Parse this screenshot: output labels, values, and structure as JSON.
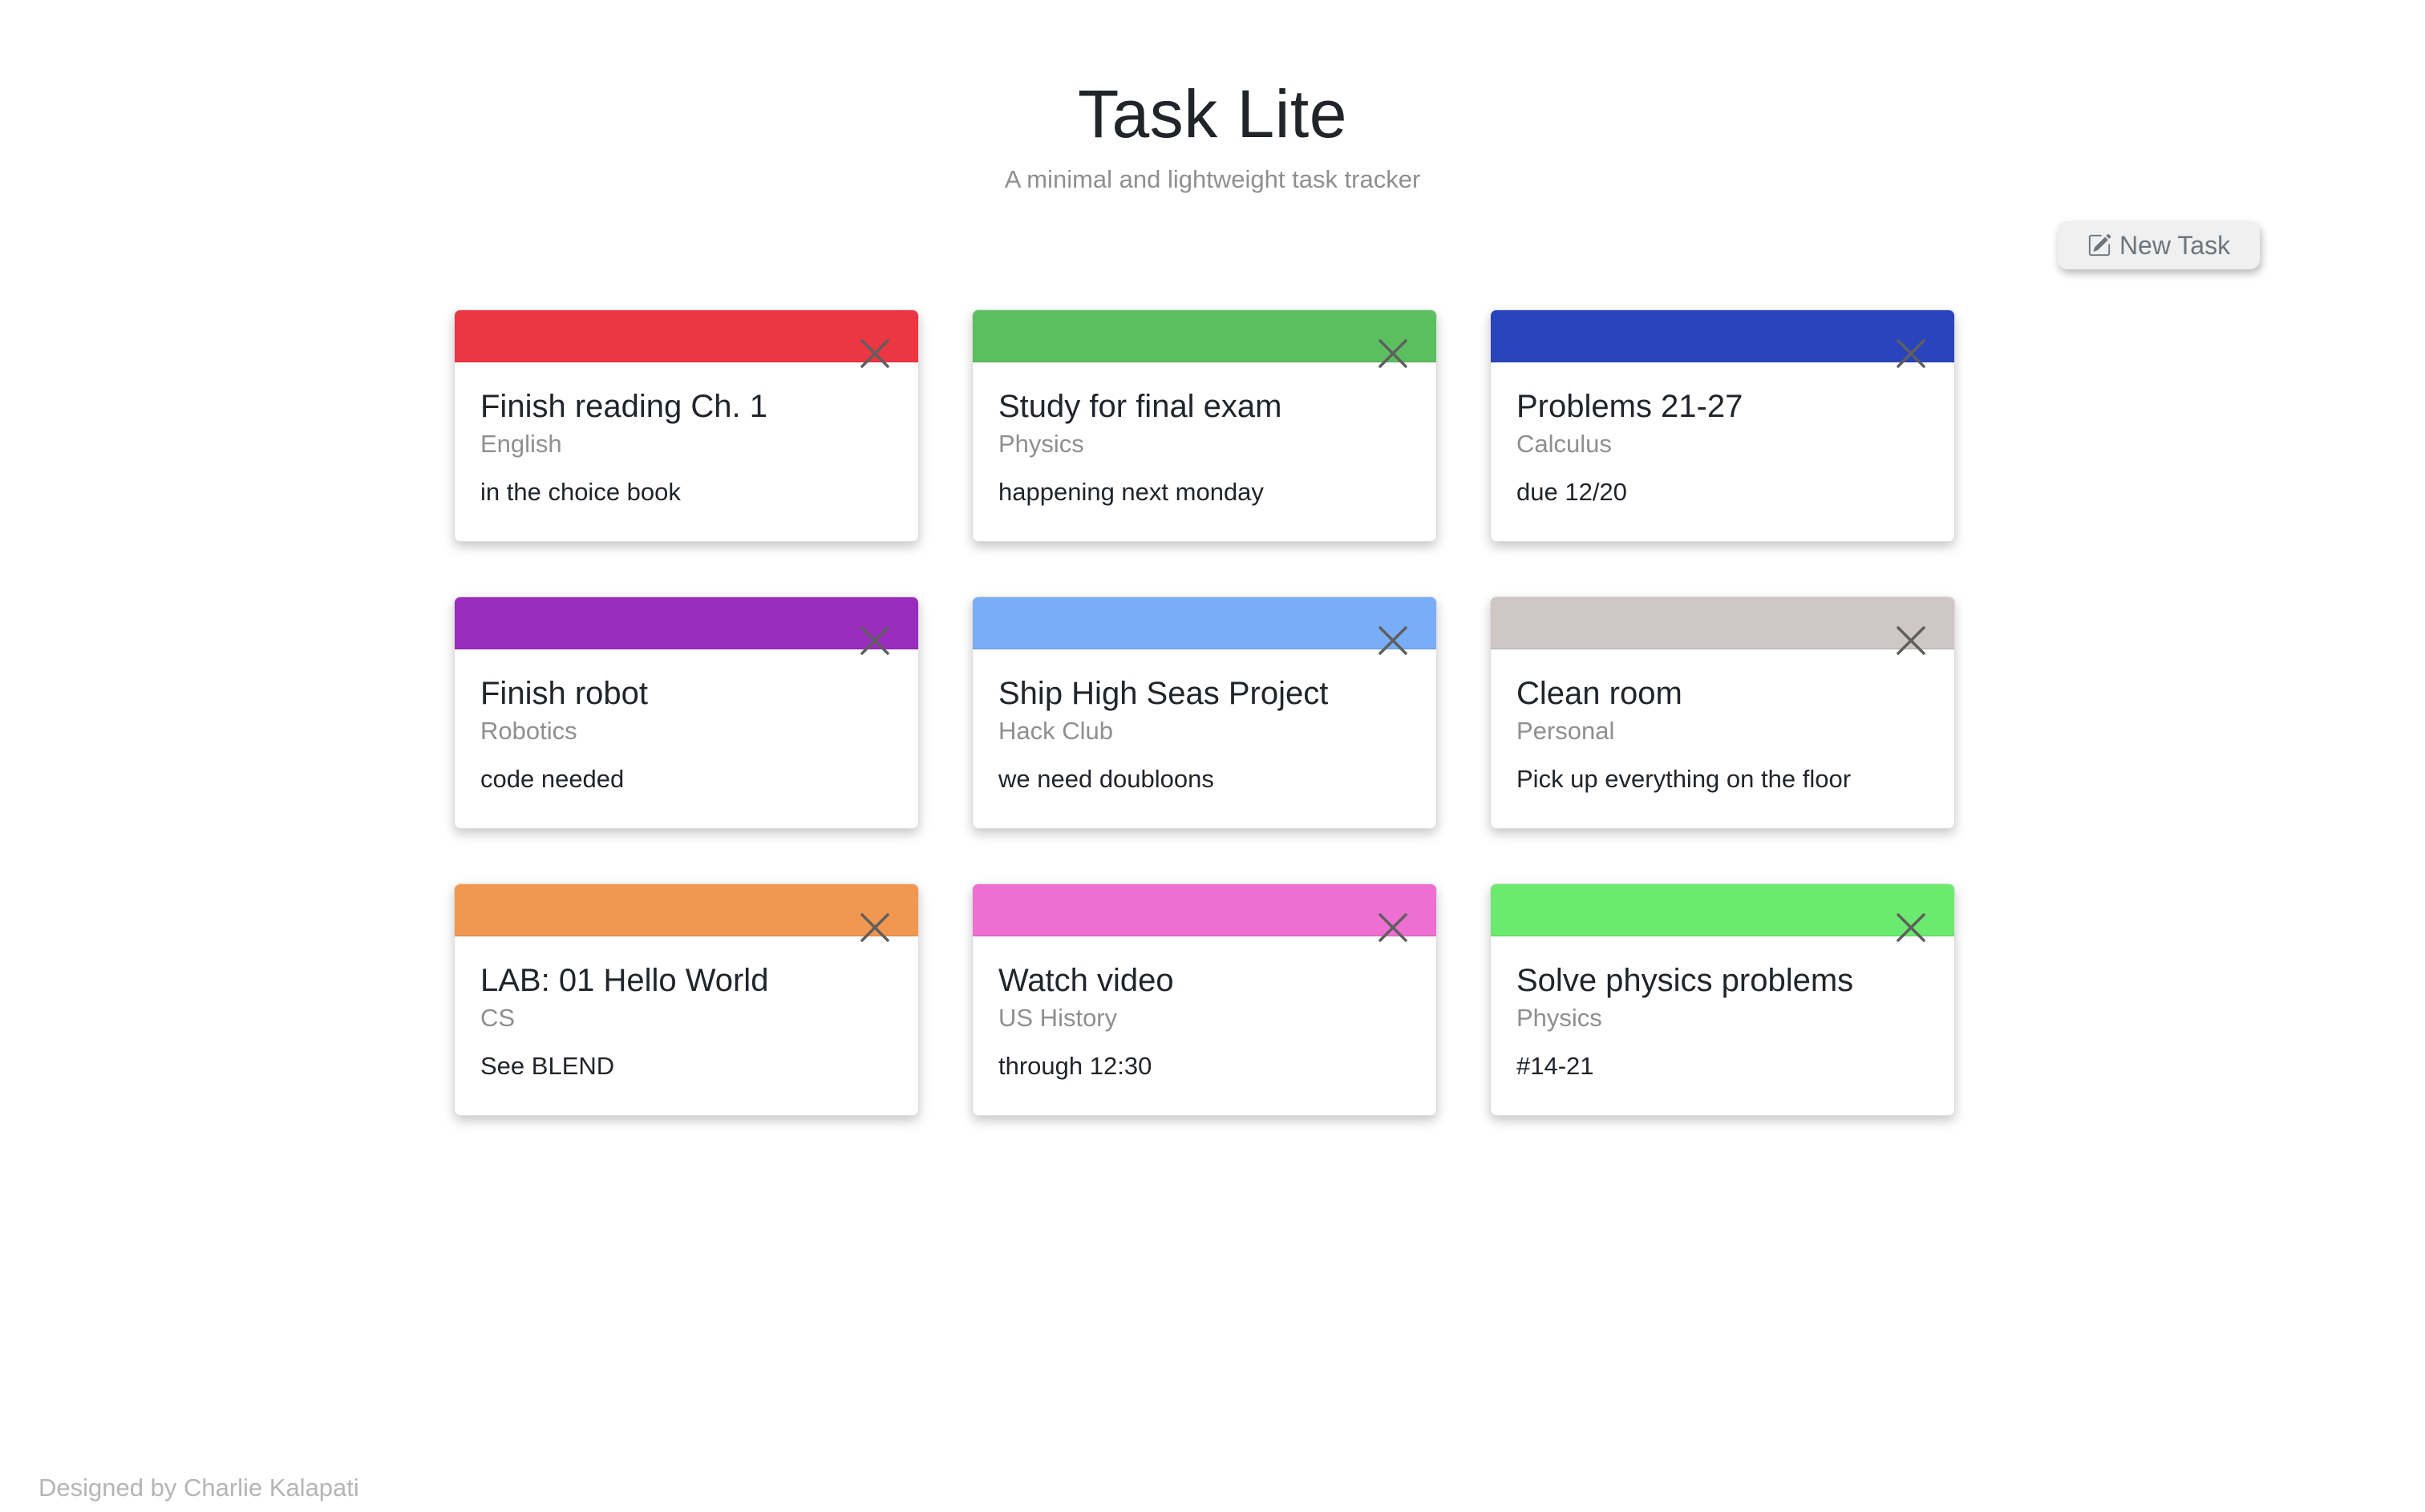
{
  "header": {
    "title": "Task Lite",
    "subtitle": "A minimal and lightweight task tracker"
  },
  "toolbar": {
    "new_task_label": "New Task",
    "new_task_icon": "edit-square-icon"
  },
  "tasks": [
    {
      "title": "Finish reading Ch. 1",
      "subject": "English",
      "notes": "in the choice book",
      "color": "#ec3642"
    },
    {
      "title": "Study for final exam",
      "subject": "Physics",
      "notes": "happening next monday",
      "color": "#5bbf5f"
    },
    {
      "title": "Problems 21-27",
      "subject": "Calculus",
      "notes": "due 12/20",
      "color": "#2a44bd"
    },
    {
      "title": "Finish robot",
      "subject": "Robotics",
      "notes": "code needed",
      "color": "#9a2cbd"
    },
    {
      "title": "Ship High Seas Project",
      "subject": "Hack Club",
      "notes": "we need doubloons",
      "color": "#79aef7"
    },
    {
      "title": "Clean room",
      "subject": "Personal",
      "notes": "Pick up everything on the floor",
      "color": "#cfc6c6"
    },
    {
      "title": "LAB: 01 Hello World",
      "subject": "CS",
      "notes": "See BLEND",
      "color": "#f2974f"
    },
    {
      "title": "Watch video",
      "subject": "US History",
      "notes": "through 12:30",
      "color": "#ee6ed1"
    },
    {
      "title": "Solve physics problems",
      "subject": "Physics",
      "notes": "#14-21",
      "color": "#6ce96f"
    }
  ],
  "footer": {
    "credit": "Designed by Charlie Kalapati"
  }
}
